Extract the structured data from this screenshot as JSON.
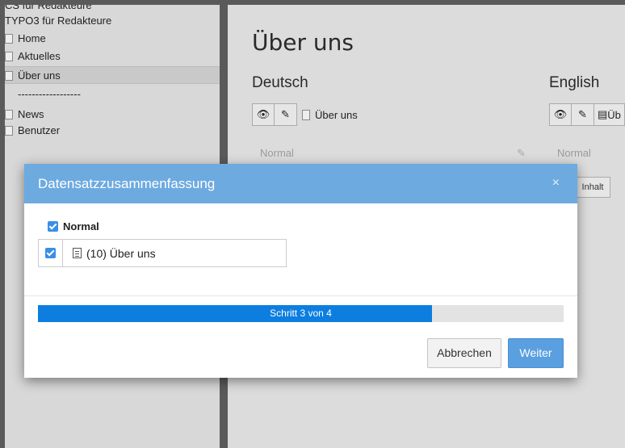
{
  "tree": {
    "cut_top": "CS für Redakteure",
    "root": "TYPO3 für Redakteure",
    "items": [
      {
        "label": "Home"
      },
      {
        "label": "Aktuelles"
      },
      {
        "label": "Über uns"
      },
      {
        "label": "------------------"
      },
      {
        "label": "News"
      },
      {
        "label": "Benutzer"
      }
    ]
  },
  "content": {
    "page_title": "Über uns",
    "lang_de": "Deutsch",
    "lang_en": "English",
    "de_page_label": "Über uns",
    "en_page_label": "Üb",
    "col_de": "Normal",
    "col_en": "Normal",
    "inhalt_button": "Inhalt"
  },
  "modal": {
    "title": "Datensatzzusammenfassung",
    "close_glyph": "×",
    "group_title": "Normal",
    "record_label": "(10) Über uns",
    "progress": {
      "label": "Schritt 3 von 4",
      "value": 0.75
    },
    "cancel_label": "Abbrechen",
    "next_label": "Weiter"
  },
  "colors": {
    "header": "#6daae0",
    "progress": "#0d7ee0",
    "primary_button": "#5a9fe0"
  }
}
